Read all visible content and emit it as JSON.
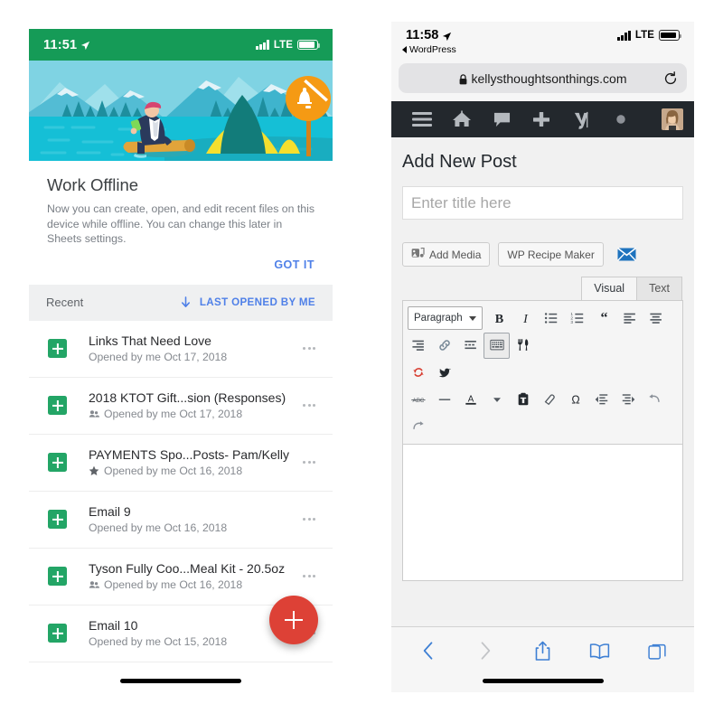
{
  "sheets_phone": {
    "status_bar": {
      "time": "11:51",
      "location_icon": "location-arrow-icon",
      "network": "LTE",
      "battery_icon": "battery-icon",
      "signal_icon": "signal-bars-icon",
      "bg_color": "#159B57"
    },
    "illustration": {
      "name": "work-offline-illustration",
      "alt": "Man in suit sitting on a log by a lake with a tent and a no-notifications sign",
      "colors": {
        "sky": "#7FD3E3",
        "water": "#15BFD6",
        "water_dark": "#0FA9C4",
        "mountain": "#53BCD4",
        "mountain_dark": "#3AAFC9",
        "snow": "#D6EEF4",
        "tree": "#1E8E9E",
        "tent_yellow": "#F5DF2E",
        "tent_dark": "#127C7A",
        "sign_orange": "#F59A14",
        "suit": "#2A3A5C"
      }
    },
    "promo": {
      "title": "Work Offline",
      "body": "Now you can create, open, and edit recent files on this device while offline. You can change this later in Sheets settings.",
      "action_label": "GOT IT",
      "action_color": "#4f80e8"
    },
    "recent_bar": {
      "label": "Recent",
      "sort_icon": "arrow-down-icon",
      "sort_label": "LAST OPENED BY ME"
    },
    "files": [
      {
        "name": "Links That Need Love",
        "subtitle": "Opened by me Oct 17, 2018",
        "badge": "none",
        "icon": "google-sheets-icon"
      },
      {
        "name": "2018 KTOT Gift...sion  (Responses)",
        "subtitle": "Opened by me Oct 17, 2018",
        "badge": "shared-icon",
        "icon": "google-sheets-icon"
      },
      {
        "name": "PAYMENTS Spo...Posts- Pam/Kelly",
        "subtitle": "Opened by me Oct 16, 2018",
        "badge": "star-icon",
        "icon": "google-sheets-icon"
      },
      {
        "name": "Email 9",
        "subtitle": "Opened by me Oct 16, 2018",
        "badge": "none",
        "icon": "google-sheets-icon"
      },
      {
        "name": "Tyson Fully Coo...Meal Kit - 20.5oz",
        "subtitle": "Opened by me Oct 16, 2018",
        "badge": "shared-icon",
        "icon": "google-sheets-icon"
      },
      {
        "name": "Email 10",
        "subtitle": "Opened by me Oct 15, 2018",
        "badge": "none",
        "icon": "google-sheets-icon"
      }
    ],
    "fab": {
      "icon": "plus-icon",
      "color": "#dd4136"
    },
    "more_menu_icon": "more-options-icon"
  },
  "safari_phone": {
    "status_bar": {
      "time": "11:58",
      "location_icon": "location-arrow-icon",
      "back_app_label": "WordPress",
      "network": "LTE",
      "battery_icon": "battery-icon",
      "signal_icon": "signal-bars-icon"
    },
    "address_bar": {
      "lock_icon": "lock-icon",
      "url": "kellysthoughtsonthings.com",
      "reload_icon": "reload-icon"
    },
    "admin_bar": {
      "bg_color": "#23282d",
      "items": [
        {
          "name": "menu-icon",
          "label": "Menu"
        },
        {
          "name": "home-icon",
          "label": "Home"
        },
        {
          "name": "comments-icon",
          "label": "Comments"
        },
        {
          "name": "new-content-icon",
          "label": "New"
        },
        {
          "name": "yoast-seo-icon",
          "label": "Yoast SEO"
        },
        {
          "name": "status-dot-icon",
          "label": "Status"
        }
      ],
      "avatar": "user-avatar"
    },
    "editor": {
      "page_title": "Add New Post",
      "title_placeholder": "Enter title here",
      "title_value": "",
      "add_media_label": "Add Media",
      "add_media_icon": "add-media-icon",
      "recipe_maker_label": "WP Recipe Maker",
      "mail_icon": "email-icon",
      "tabs": [
        {
          "label": "Visual",
          "active": true
        },
        {
          "label": "Text",
          "active": false
        }
      ],
      "format_select": "Paragraph",
      "toolbar_row1": [
        {
          "name": "bold-icon",
          "glyph": "B"
        },
        {
          "name": "italic-icon",
          "glyph": "I"
        },
        {
          "name": "bulleted-list-icon",
          "glyph": ""
        },
        {
          "name": "numbered-list-icon",
          "glyph": ""
        },
        {
          "name": "blockquote-icon",
          "glyph": "“"
        },
        {
          "name": "align-left-icon",
          "glyph": ""
        },
        {
          "name": "align-center-icon",
          "glyph": ""
        }
      ],
      "toolbar_row2": [
        {
          "name": "align-right-icon"
        },
        {
          "name": "insert-link-icon"
        },
        {
          "name": "read-more-icon"
        },
        {
          "name": "toolbar-toggle-icon",
          "active": true
        },
        {
          "name": "recipe-fork-knife-icon"
        }
      ],
      "toolbar_row3": [
        {
          "name": "revive-old-post-icon"
        },
        {
          "name": "twitter-icon"
        }
      ],
      "toolbar_row4": [
        {
          "name": "strikethrough-icon",
          "glyph": "ABC"
        },
        {
          "name": "horizontal-rule-icon"
        },
        {
          "name": "text-color-icon",
          "glyph": "A"
        },
        {
          "name": "text-color-dropdown-icon"
        },
        {
          "name": "paste-as-text-icon"
        },
        {
          "name": "clear-formatting-icon"
        },
        {
          "name": "special-character-icon",
          "glyph": "Ω"
        },
        {
          "name": "outdent-icon"
        },
        {
          "name": "indent-icon"
        },
        {
          "name": "undo-icon"
        }
      ],
      "toolbar_row5": [
        {
          "name": "redo-icon"
        }
      ],
      "content_value": ""
    },
    "bottom_bar": [
      {
        "name": "back-icon",
        "enabled": true
      },
      {
        "name": "forward-icon",
        "enabled": false
      },
      {
        "name": "share-icon",
        "enabled": true
      },
      {
        "name": "bookmarks-icon",
        "enabled": true
      },
      {
        "name": "tabs-icon",
        "enabled": true
      }
    ],
    "accent_color": "#3d7fd4"
  }
}
